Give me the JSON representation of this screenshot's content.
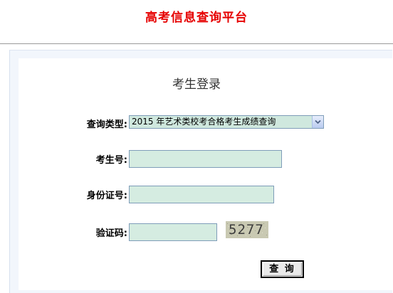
{
  "header": {
    "site_title": "高考信息查询平台"
  },
  "form": {
    "heading": "考生登录",
    "query_type": {
      "label": "查询类型:",
      "selected": "2015 年艺术类校考合格考生成绩查询"
    },
    "exam_number": {
      "label": "考生号:",
      "value": ""
    },
    "id_number": {
      "label": "身份证号:",
      "value": ""
    },
    "captcha": {
      "label": "验证码:",
      "value": "",
      "code": "5277"
    },
    "submit_label": "查 询"
  },
  "colors": {
    "title": "#e60000",
    "input_bg": "#d5ece1",
    "panel_bg": "#f2f6fc"
  },
  "icons": {
    "select_arrow": "chevron-down-icon"
  }
}
